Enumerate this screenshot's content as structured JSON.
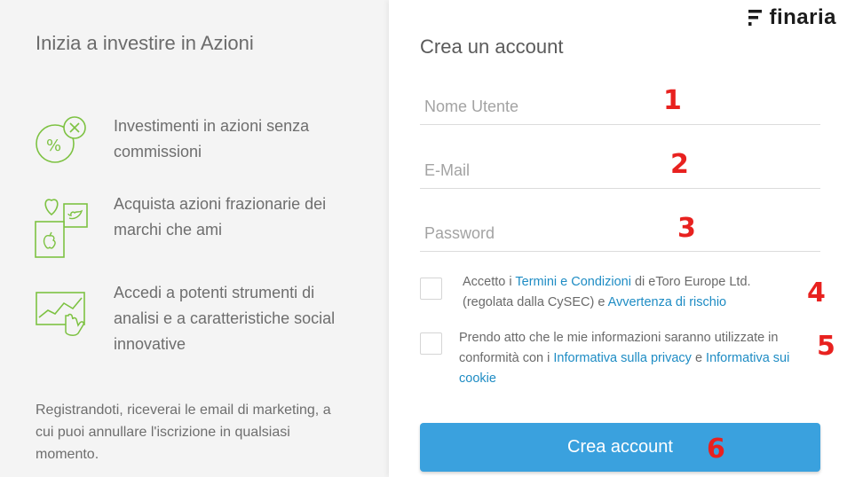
{
  "left": {
    "title": "Inizia a investire in Azioni",
    "features": [
      {
        "icon": "percent-no-commission-icon",
        "text": "Investimenti in azioni senza commissioni"
      },
      {
        "icon": "brands-fractional-icon",
        "text": "Acquista azioni frazionarie dei marchi che ami"
      },
      {
        "icon": "chart-touch-icon",
        "text": "Accedi a potenti strumenti di analisi e a caratteristiche social innovative"
      }
    ],
    "note": "Registrandoti, riceverai le email di marketing, a cui puoi annullare l'iscrizione in qualsiasi momento."
  },
  "brand": {
    "name": "finaria",
    "icon": "finaria-logo-icon"
  },
  "form": {
    "title": "Crea un account",
    "username_placeholder": "Nome Utente",
    "email_placeholder": "E-Mail",
    "password_placeholder": "Password",
    "consent1": {
      "pre": "Accetto i ",
      "link1": "Termini e Condizioni",
      "mid": " di eToro Europe Ltd. (regolata dalla CySEC) e ",
      "link2": "Avvertenza di rischio"
    },
    "consent2": {
      "pre": "Prendo atto che le mie informazioni saranno utilizzate in conformità con i ",
      "link1": "Informativa sulla privacy",
      "mid": " e ",
      "link2": "Informativa sui cookie"
    },
    "submit_label": "Crea account"
  },
  "markers": [
    "1",
    "2",
    "3",
    "4",
    "5",
    "6"
  ],
  "colors": {
    "accent": "#3aa1de",
    "link": "#1e8cc4",
    "icon_green": "#7dc242",
    "marker_red": "#e8211f"
  }
}
